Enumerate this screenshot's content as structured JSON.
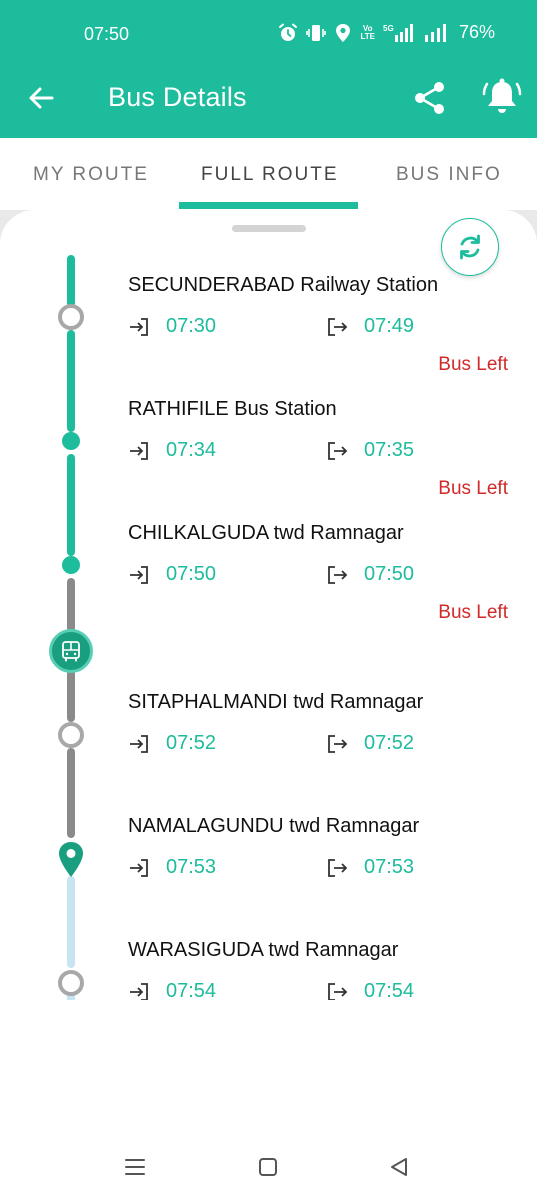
{
  "status_bar": {
    "time": "07:50",
    "network_label": "5G",
    "volte_label": "VoLTE",
    "battery": "76%"
  },
  "toolbar": {
    "title": "Bus Details",
    "icons": [
      "back-arrow-icon",
      "share-icon",
      "alarm-bell-icon"
    ]
  },
  "tabs": [
    {
      "label": "MY ROUTE",
      "active": false
    },
    {
      "label": "FULL ROUTE",
      "active": true
    },
    {
      "label": "BUS INFO",
      "active": false
    }
  ],
  "stops": [
    {
      "name": "SECUNDERABAD Railway Station",
      "arrival": "07:30",
      "departure": "07:49",
      "status": "Bus Left"
    },
    {
      "name": "RATHIFILE Bus Station",
      "arrival": "07:34",
      "departure": "07:35",
      "status": "Bus Left"
    },
    {
      "name": "CHILKALGUDA twd Ramnagar",
      "arrival": "07:50",
      "departure": "07:50",
      "status": "Bus Left"
    },
    {
      "name": "SITAPHALMANDI twd Ramnagar",
      "arrival": "07:52",
      "departure": "07:52",
      "status": ""
    },
    {
      "name": "NAMALAGUNDU twd Ramnagar",
      "arrival": "07:53",
      "departure": "07:53",
      "status": ""
    },
    {
      "name": "WARASIGUDA twd Ramnagar",
      "arrival": "07:54",
      "departure": "07:54",
      "status": ""
    }
  ],
  "colors": {
    "accent": "#1cbc9c",
    "status_left": "#d02a2a",
    "timeline_passed": "#1cbc9c",
    "timeline_upcoming": "#8a8a8a",
    "timeline_future": "#c7e4f2"
  }
}
